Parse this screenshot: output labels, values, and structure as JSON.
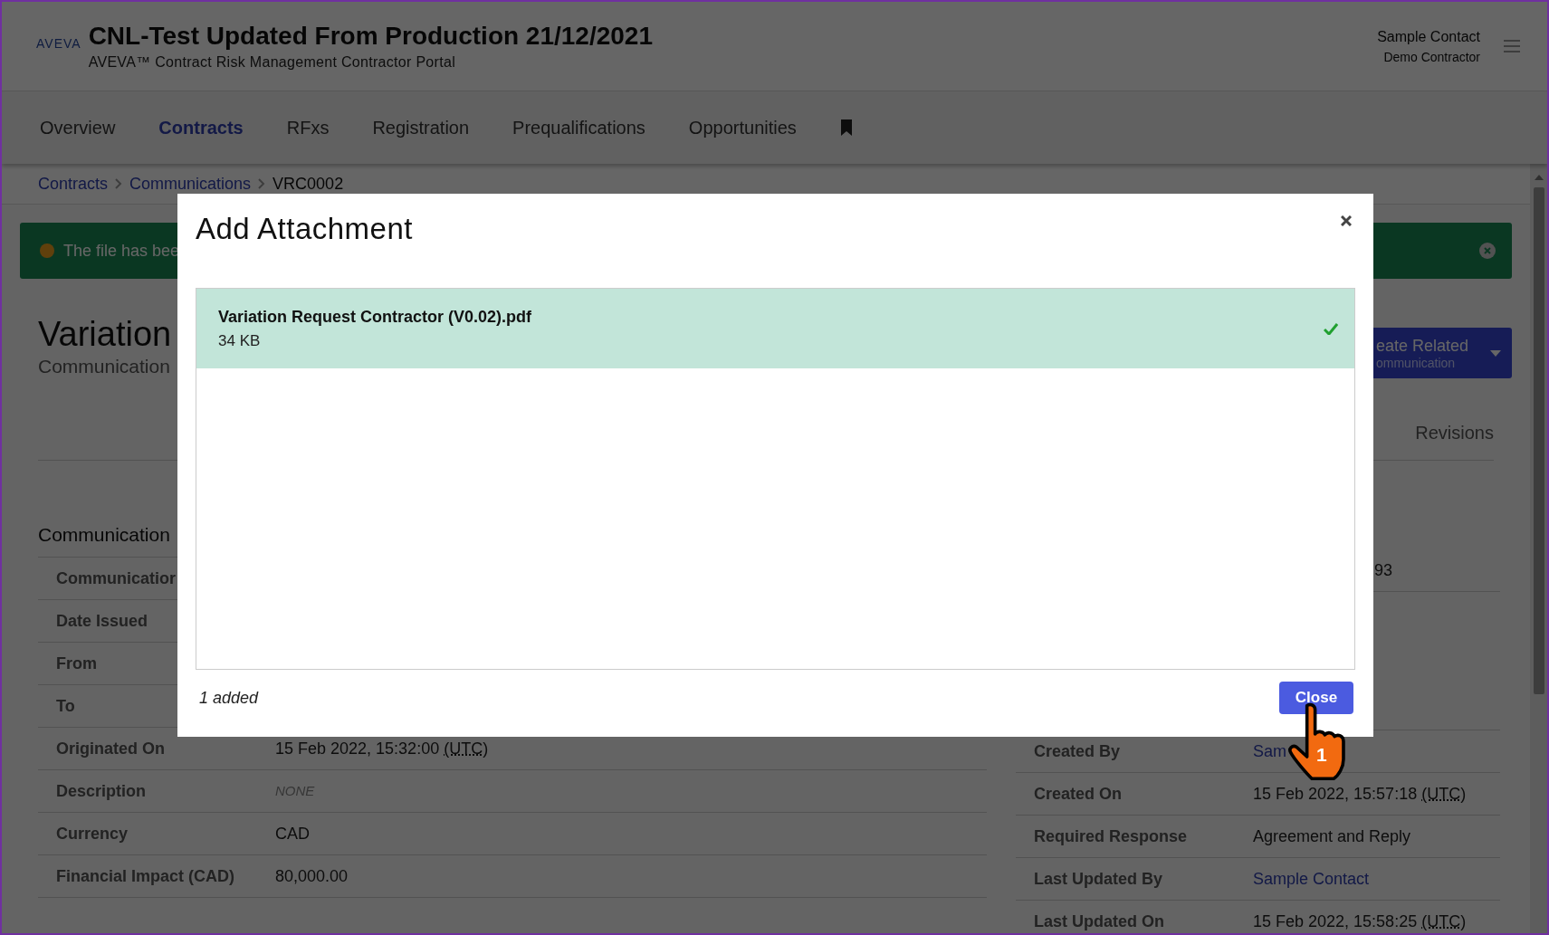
{
  "header": {
    "logo": "AVEVA",
    "title": "CNL-Test Updated From Production 21/12/2021",
    "subtitle": "AVEVA™ Contract Risk Management Contractor Portal",
    "user_name": "Sample Contact",
    "user_org": "Demo Contractor"
  },
  "nav": [
    {
      "label": "Overview",
      "selected": false
    },
    {
      "label": "Contracts",
      "selected": true
    },
    {
      "label": "RFxs",
      "selected": false
    },
    {
      "label": "Registration",
      "selected": false
    },
    {
      "label": "Prequalifications",
      "selected": false
    },
    {
      "label": "Opportunities",
      "selected": false
    }
  ],
  "breadcrumb": [
    "Contracts",
    "Communications",
    "VRC0002"
  ],
  "alert": {
    "text": "The file has bee"
  },
  "page_title": "Variation",
  "page_subtitle": "Communication",
  "create_button": {
    "label": "eate Related",
    "sublabel": "ommunication"
  },
  "tabs": [
    {
      "label": "Revisions",
      "selected": false
    }
  ],
  "details_left": {
    "heading": "Communication",
    "rows": [
      {
        "label": "Communicatior"
      },
      {
        "label": "Date Issued"
      },
      {
        "label": "From"
      },
      {
        "label": "To"
      },
      {
        "label": "Originated On",
        "value": "15 Feb 2022, 15:32:00",
        "zone": "(UTC)",
        "kind": "date"
      },
      {
        "label": "Description",
        "value": "NONE",
        "kind": "empty"
      },
      {
        "label": "Currency",
        "value": "CAD",
        "kind": "text"
      },
      {
        "label": "Financial Impact (CAD)",
        "value": "80,000.00",
        "kind": "text"
      }
    ]
  },
  "details_right": {
    "rows": [
      {
        "value": "93",
        "kind": "clipped"
      },
      {
        "label": "Created By",
        "value": "Sam",
        "kind": "link"
      },
      {
        "label": "Created On",
        "value": "15 Feb 2022, 15:57:18",
        "zone": "(UTC)",
        "kind": "date"
      },
      {
        "label": "Required Response",
        "value": "Agreement and Reply",
        "kind": "text"
      },
      {
        "label": "Last Updated By",
        "value": "Sample Contact",
        "kind": "link"
      },
      {
        "label": "Last Updated On",
        "value": "15 Feb 2022, 15:58:25",
        "zone": "(UTC)",
        "kind": "date"
      }
    ]
  },
  "modal": {
    "title": "Add Attachment",
    "files": [
      {
        "name": "Variation Request Contractor (V0.02).pdf",
        "size": "34 KB",
        "done": true
      }
    ],
    "summary": "1 added",
    "close_label": "Close"
  },
  "cursor": {
    "badge": "1"
  }
}
